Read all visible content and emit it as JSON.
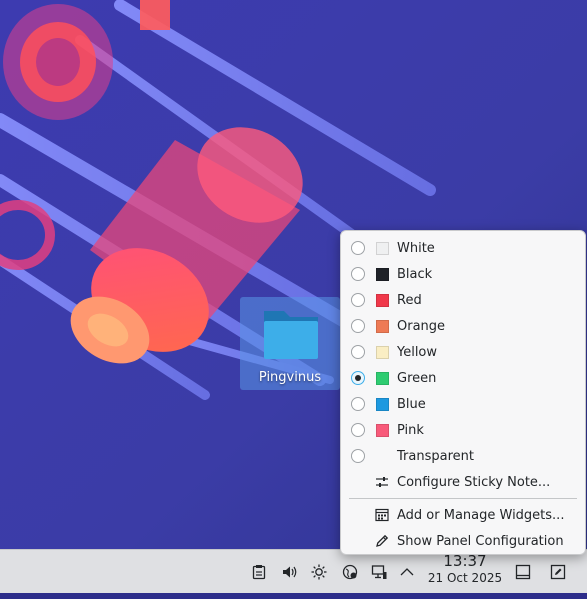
{
  "desktop": {
    "icon": {
      "label": "Pingvinus",
      "icon": "folder-icon"
    }
  },
  "context_menu": {
    "colors": [
      {
        "label": "White",
        "color": "#eff0f1",
        "checked": false
      },
      {
        "label": "Black",
        "color": "#1f2228",
        "checked": false
      },
      {
        "label": "Red",
        "color": "#f0384a",
        "checked": false
      },
      {
        "label": "Orange",
        "color": "#ee7a55",
        "checked": false
      },
      {
        "label": "Yellow",
        "color": "#faeec4",
        "checked": false
      },
      {
        "label": "Green",
        "color": "#2ecc71",
        "checked": true
      },
      {
        "label": "Blue",
        "color": "#1d99e0",
        "checked": false
      },
      {
        "label": "Pink",
        "color": "#f85a7a",
        "checked": false
      },
      {
        "label": "Transparent",
        "color": "",
        "checked": false
      }
    ],
    "configure_label": "Configure Sticky Note...",
    "add_widgets_label": "Add or Manage Widgets...",
    "panel_config_label": "Show Panel Configuration"
  },
  "taskbar": {
    "clock": {
      "time": "13:37",
      "date": "21 Oct 2025"
    },
    "tray_icons": [
      "clipboard-icon",
      "volume-icon",
      "brightness-icon",
      "network-icon",
      "display-icon",
      "chevron-up-icon"
    ],
    "right_icons": [
      "show-desktop-icon",
      "edit-panel-icon"
    ]
  }
}
